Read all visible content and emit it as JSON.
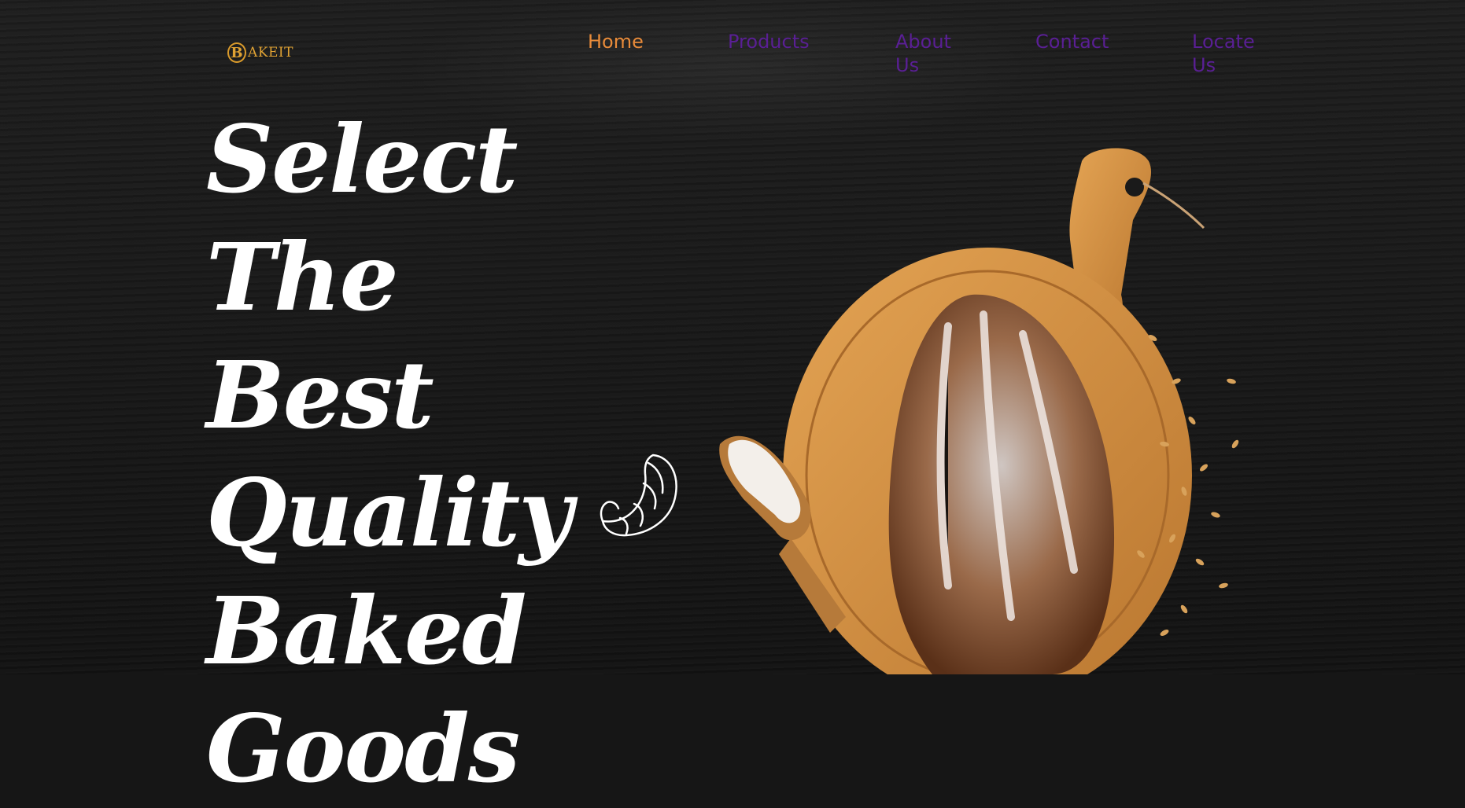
{
  "header": {
    "logo": {
      "mark": "B",
      "text": "AKEIT",
      "alt": "BAKEIT"
    },
    "nav": [
      {
        "label": "Home",
        "active": true
      },
      {
        "label": "Products",
        "active": false
      },
      {
        "label": "About Us",
        "active": false
      },
      {
        "label": "Contact",
        "active": false
      },
      {
        "label": "Locate Us",
        "active": false
      }
    ]
  },
  "hero": {
    "headline_lines": [
      "Select The",
      "Best",
      "Quality",
      "Baked",
      "Goods"
    ]
  },
  "colors": {
    "background": "#161616",
    "nav_active": "#e88b3a",
    "nav_inactive": "#5a1f95",
    "logo": "#e0a233",
    "headline": "#ffffff"
  },
  "icons": [
    "croissant-icon",
    "bread-board-image"
  ]
}
